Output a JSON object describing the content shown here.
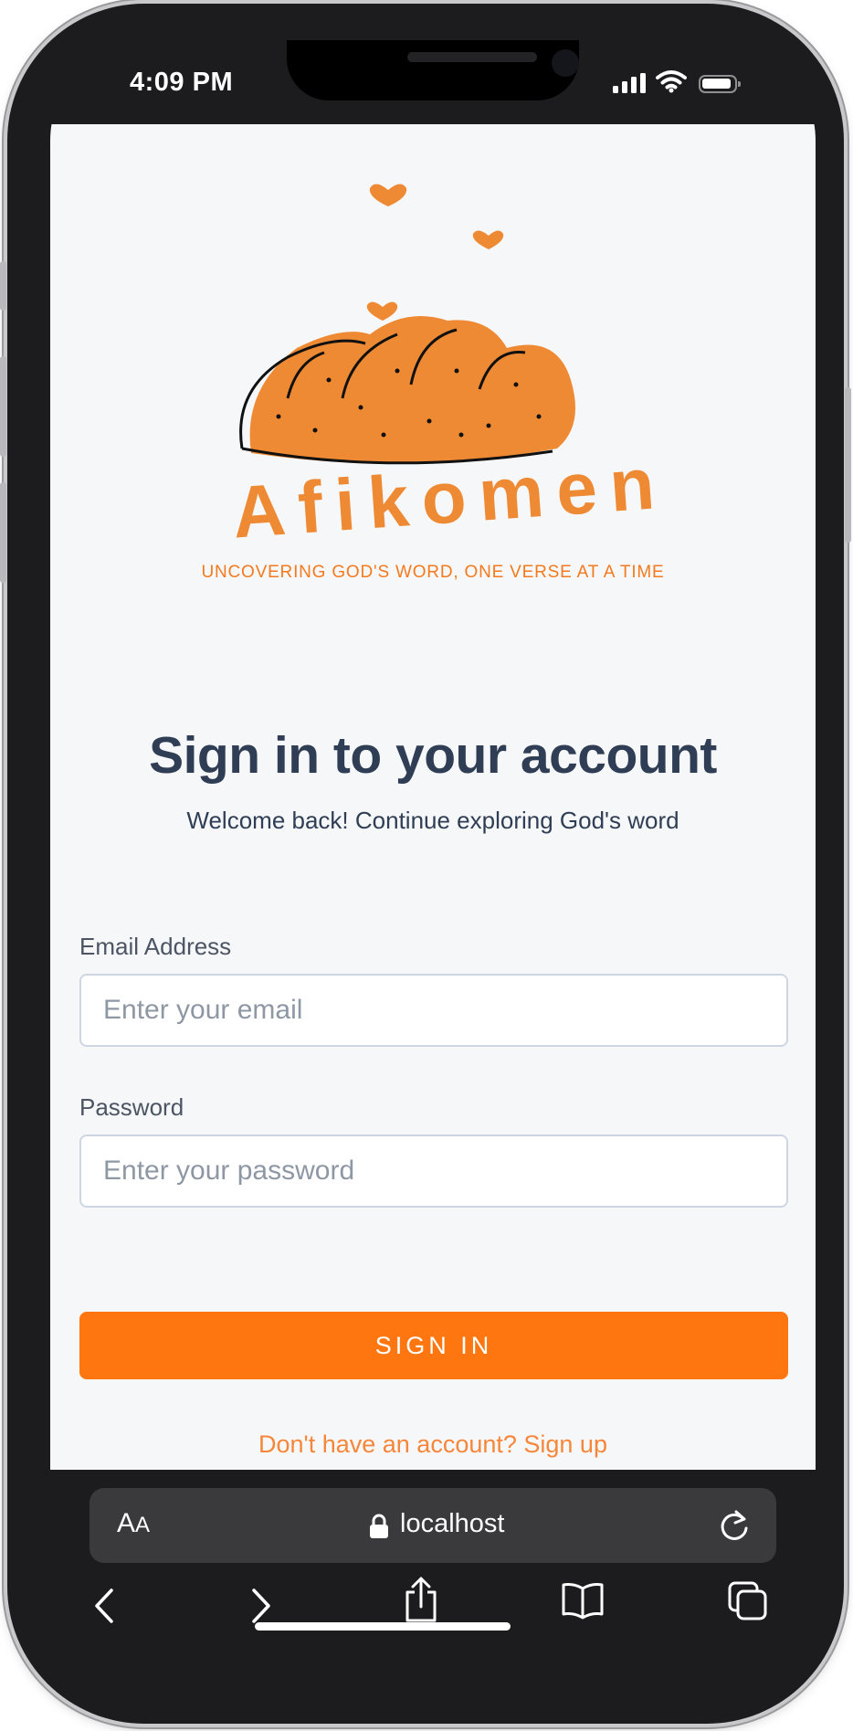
{
  "status_bar": {
    "time": "4:09 PM",
    "icons": [
      "signal-icon",
      "wifi-icon",
      "battery-icon"
    ]
  },
  "brand": {
    "name": "Afikomen",
    "tagline": "UNCOVERING GOD'S WORD, ONE VERSE AT A TIME",
    "accent_color": "#fd760f"
  },
  "login": {
    "title": "Sign in to your account",
    "subtitle": "Welcome back! Continue exploring God's word",
    "email": {
      "label": "Email Address",
      "placeholder": "Enter your email",
      "value": ""
    },
    "password": {
      "label": "Password",
      "placeholder": "Enter your password",
      "value": ""
    },
    "submit_label": "SIGN IN",
    "signup_text": "Don't have an account? Sign up"
  },
  "browser": {
    "text_size_label_big": "A",
    "text_size_label_small": "A",
    "url": "localhost",
    "toolbar_icons": [
      "back-icon",
      "forward-icon",
      "share-icon",
      "bookmarks-icon",
      "tabs-icon"
    ]
  }
}
